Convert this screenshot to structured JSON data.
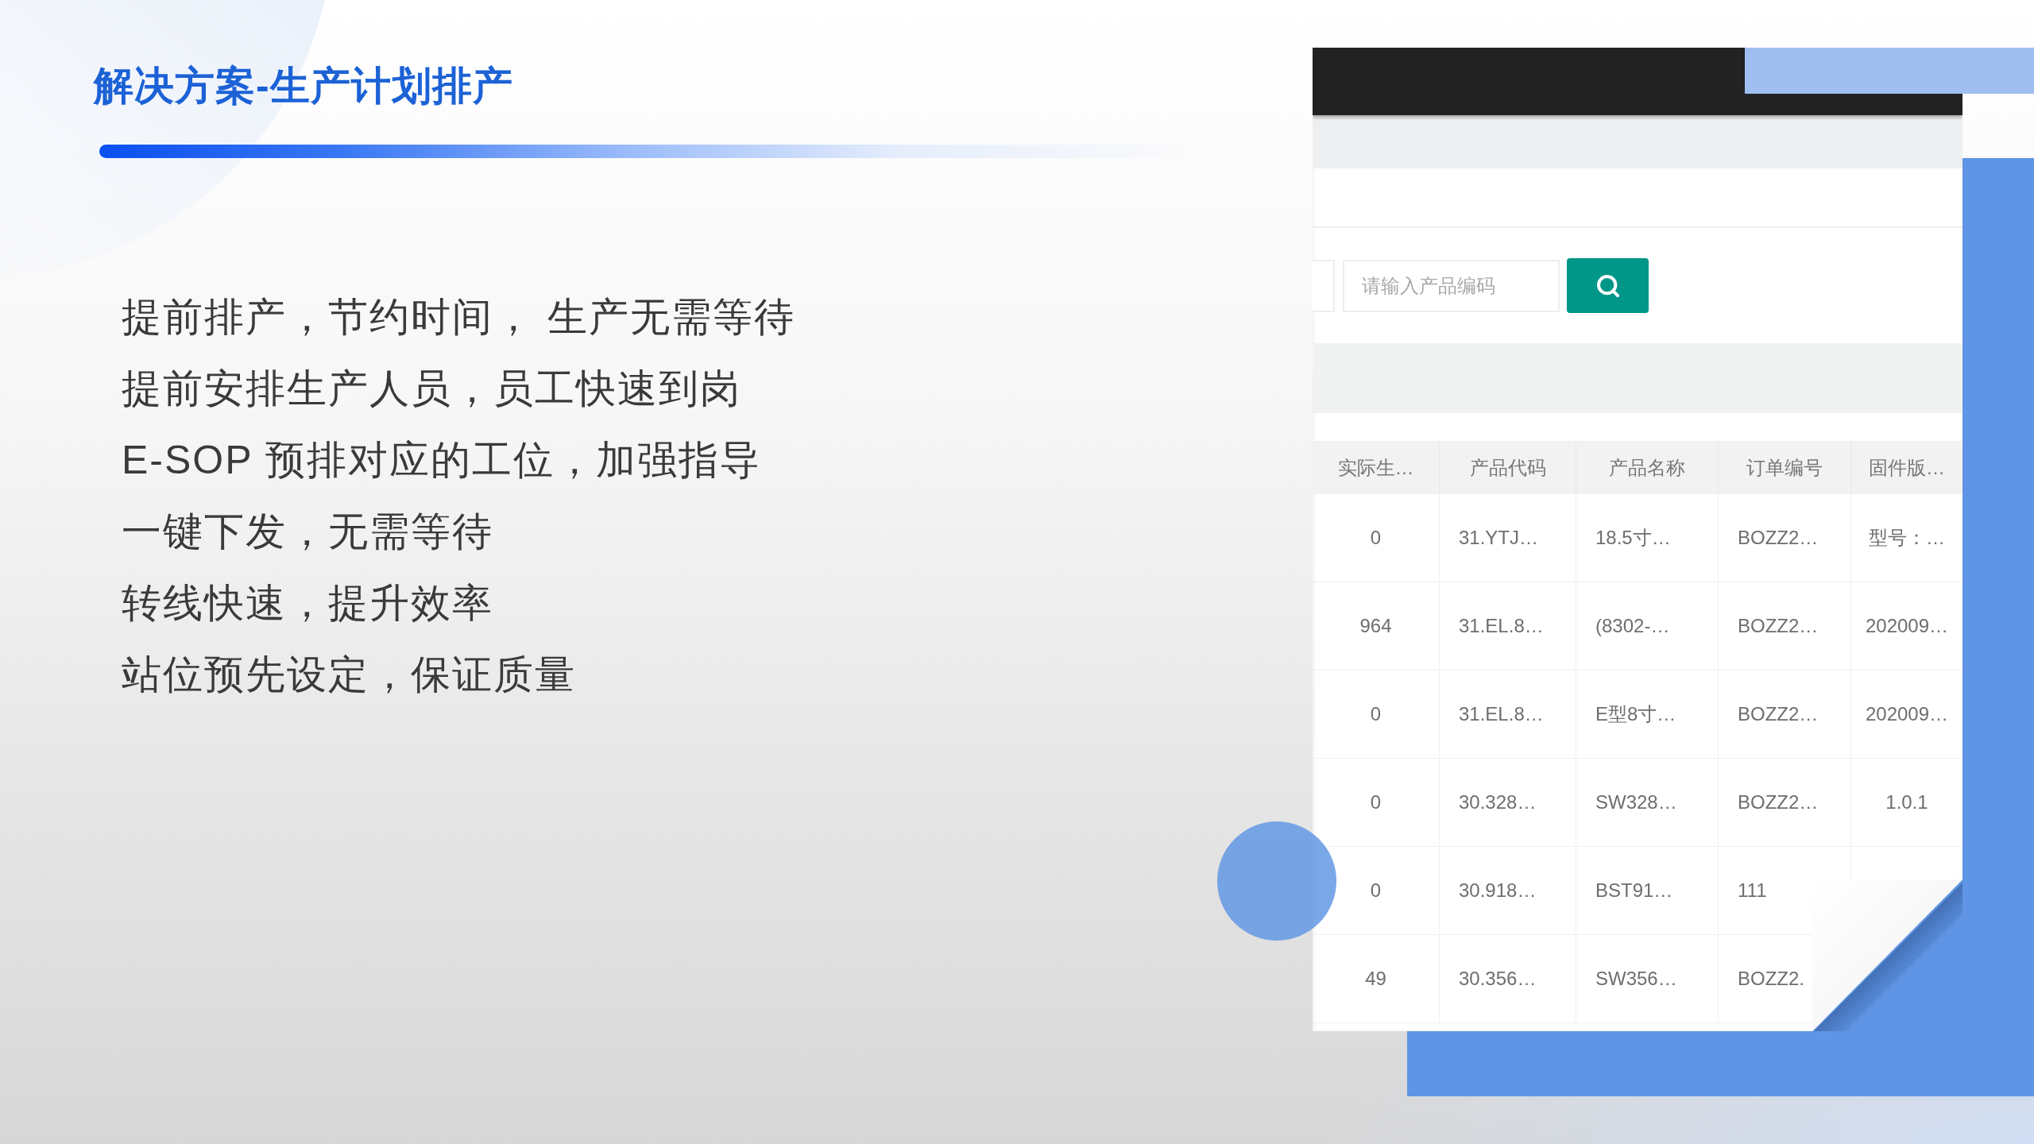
{
  "slide": {
    "title": "解决方案-生产计划排产"
  },
  "points": [
    "提前排产，节约时间， 生产无需等待",
    "提前安排生产人员，员工快速到岗",
    "E-SOP 预排对应的工位，加强指导",
    "一键下发，无需等待",
    "转线快速，提升效率",
    "站位预先设定，保证质量"
  ],
  "screenshot": {
    "search": {
      "placeholder": "请输入产品编码"
    },
    "table": {
      "columns": [
        "实际生…",
        "产品代码",
        "产品名称",
        "订单编号",
        "固件版…"
      ],
      "rows": [
        [
          "0",
          "31.YTJ…",
          "18.5寸…",
          "BOZZ2…",
          "型号：…"
        ],
        [
          "964",
          "31.EL.8…",
          "(8302-…",
          "BOZZ2…",
          "202009…"
        ],
        [
          "0",
          "31.EL.8…",
          "E型8寸…",
          "BOZZ2…",
          "202009…"
        ],
        [
          "0",
          "30.328…",
          "SW328…",
          "BOZZ2…",
          "1.0.1"
        ],
        [
          "0",
          "30.918…",
          "BST91…",
          "111"
        ],
        [
          "49",
          "30.356…",
          "SW356…",
          "BOZZ2."
        ]
      ]
    }
  }
}
